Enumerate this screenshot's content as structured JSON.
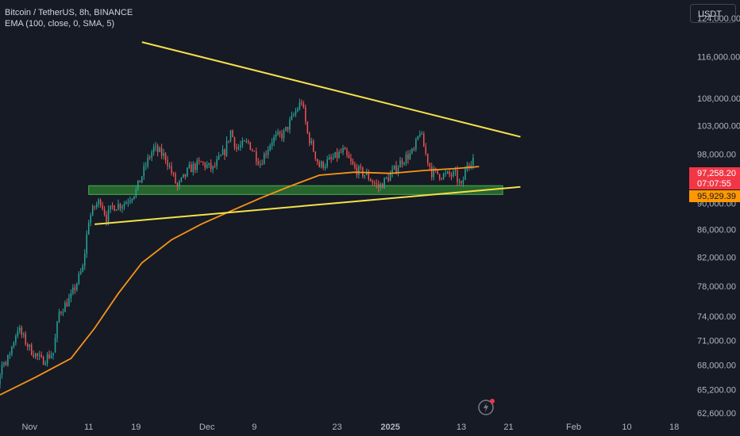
{
  "legend": {
    "symbol_line": "Bitcoin / TetherUS, 8h, BINANCE",
    "indicator_line": "EMA (100, close, 0, SMA, 5)"
  },
  "currency_button": "USDT",
  "price_badges": {
    "last_price": "97,258.20",
    "countdown": "07:07:55",
    "ema_value": "95,929.39"
  },
  "colors": {
    "background": "#161a25",
    "up_candle": "#26a69a",
    "down_candle": "#ef5350",
    "ema_line": "#f7931a",
    "trendlines": "#f5e14a",
    "support_zone": "#2e7d32",
    "last_price_badge": "#f23645",
    "ema_badge": "#ff9800"
  },
  "icons": {
    "alert": "lightning-bolt-icon"
  },
  "chart_data": {
    "type": "candlestick",
    "title": "Bitcoin / TetherUS, 8h, BINANCE",
    "y_axis": {
      "scale": "log",
      "tick_labels": [
        "124,000.00",
        "116,000.00",
        "108,000.00",
        "103,000.00",
        "98,000.00",
        "90,000.00",
        "86,000.00",
        "82,000.00",
        "78,000.00",
        "74,000.00",
        "71,000.00",
        "68,000.00",
        "65,200.00",
        "62,600.00"
      ],
      "range": [
        62000,
        128000
      ]
    },
    "x_axis": {
      "tick_labels": [
        "Nov",
        "11",
        "19",
        "Dec",
        "9",
        "23",
        "2025",
        "13",
        "21",
        "Feb",
        "10",
        "18"
      ],
      "range": [
        "2024-10-27",
        "2025-02-20"
      ]
    },
    "series": [
      {
        "name": "Close",
        "kind": "price",
        "points": [
          [
            "2024-10-28",
            68000
          ],
          [
            "2024-10-30",
            72500
          ],
          [
            "2024-11-01",
            70000
          ],
          [
            "2024-11-03",
            68500
          ],
          [
            "2024-11-05",
            69500
          ],
          [
            "2024-11-06",
            74500
          ],
          [
            "2024-11-08",
            76500
          ],
          [
            "2024-11-10",
            80500
          ],
          [
            "2024-11-11",
            87500
          ],
          [
            "2024-11-12",
            89500
          ],
          [
            "2024-11-13",
            90500
          ],
          [
            "2024-11-14",
            87800
          ],
          [
            "2024-11-15",
            89500
          ],
          [
            "2024-11-17",
            90000
          ],
          [
            "2024-11-19",
            92000
          ],
          [
            "2024-11-21",
            97000
          ],
          [
            "2024-11-22",
            99000
          ],
          [
            "2024-11-24",
            97500
          ],
          [
            "2024-11-26",
            92500
          ],
          [
            "2024-11-28",
            95500
          ],
          [
            "2024-11-30",
            96500
          ],
          [
            "2024-12-02",
            95500
          ],
          [
            "2024-12-04",
            98500
          ],
          [
            "2024-12-05",
            102000
          ],
          [
            "2024-12-06",
            99000
          ],
          [
            "2024-12-08",
            100000
          ],
          [
            "2024-12-10",
            96500
          ],
          [
            "2024-12-12",
            100500
          ],
          [
            "2024-12-14",
            101500
          ],
          [
            "2024-12-16",
            105500
          ],
          [
            "2024-12-17",
            107500
          ],
          [
            "2024-12-18",
            101500
          ],
          [
            "2024-12-20",
            96000
          ],
          [
            "2024-12-22",
            97000
          ],
          [
            "2024-12-24",
            98500
          ],
          [
            "2024-12-26",
            95500
          ],
          [
            "2024-12-28",
            94500
          ],
          [
            "2024-12-30",
            92500
          ],
          [
            "2025-01-01",
            94500
          ],
          [
            "2025-01-03",
            97000
          ],
          [
            "2025-01-05",
            98500
          ],
          [
            "2025-01-06",
            102000
          ],
          [
            "2025-01-07",
            98000
          ],
          [
            "2025-01-08",
            95000
          ],
          [
            "2025-01-10",
            94500
          ],
          [
            "2025-01-12",
            94500
          ],
          [
            "2025-01-13",
            92500
          ],
          [
            "2025-01-14",
            96500
          ],
          [
            "2025-01-15",
            97258.2
          ]
        ]
      },
      {
        "name": "EMA (100, close, 0, SMA, 5)",
        "kind": "ema",
        "points": [
          [
            "2024-10-27",
            64600
          ],
          [
            "2024-11-02",
            66600
          ],
          [
            "2024-11-08",
            68800
          ],
          [
            "2024-11-12",
            72500
          ],
          [
            "2024-11-16",
            77000
          ],
          [
            "2024-11-20",
            81200
          ],
          [
            "2024-11-25",
            84500
          ],
          [
            "2024-11-30",
            86800
          ],
          [
            "2024-12-05",
            88800
          ],
          [
            "2024-12-10",
            90800
          ],
          [
            "2024-12-15",
            92700
          ],
          [
            "2024-12-20",
            94500
          ],
          [
            "2024-12-26",
            95000
          ],
          [
            "2025-01-01",
            94800
          ],
          [
            "2025-01-07",
            95300
          ],
          [
            "2025-01-12",
            95600
          ],
          [
            "2025-01-16",
            95929.39
          ]
        ]
      }
    ],
    "annotations": [
      {
        "type": "trendline",
        "from": [
          "2024-11-20",
          119000
        ],
        "to": [
          "2025-01-23",
          101000
        ]
      },
      {
        "type": "trendline",
        "from": [
          "2024-11-12",
          86800
        ],
        "to": [
          "2025-01-23",
          92600
        ]
      },
      {
        "type": "zone",
        "from_date": "2024-11-11",
        "to_date": "2025-01-20",
        "low": 91400,
        "high": 92800
      }
    ]
  }
}
